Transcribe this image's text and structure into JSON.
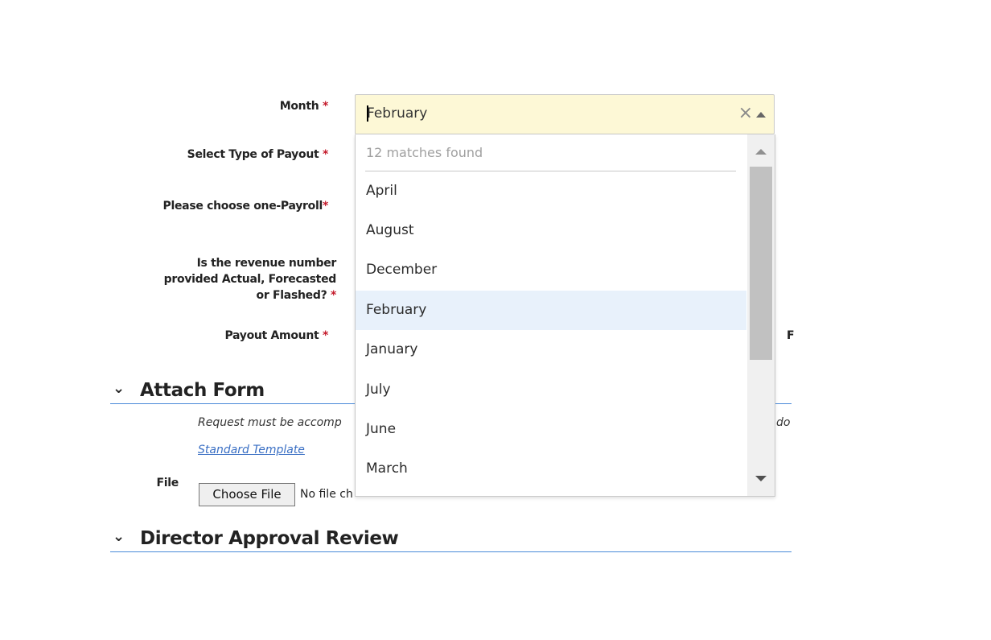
{
  "form": {
    "month_label": "Month",
    "payout_type_label": "Select Type of Payout",
    "payroll_label": "Please choose one-Payroll",
    "revenue_label_line1": "Is the revenue number",
    "revenue_label_line2": "provided Actual, Forecasted",
    "revenue_label_line3": "or Flashed?",
    "payout_amount_label": "Payout Amount",
    "required_marker": "*",
    "right_edge_fragment": "F"
  },
  "month_combo": {
    "value": "February",
    "clear_glyph": "×",
    "matches_text": "12 matches found",
    "options": [
      "April",
      "August",
      "December",
      "February",
      "January",
      "July",
      "June",
      "March"
    ],
    "highlighted": "February"
  },
  "attach_form": {
    "chevron": "⌄",
    "title": "Attach Form",
    "instructions_left": "Request must be accomp",
    "instructions_right": "do",
    "template_link": "Standard Template",
    "file_label": "File",
    "choose_file_button": "Choose File",
    "no_file_text": "No file ch"
  },
  "director_approval": {
    "chevron": "⌄",
    "title": "Director Approval Review"
  },
  "colors": {
    "combo_bg": "#fdf8d6",
    "highlight_bg": "#e8f1fb",
    "section_rule": "#4a8ad8",
    "required": "#c4192a",
    "link": "#3a6fc4"
  }
}
